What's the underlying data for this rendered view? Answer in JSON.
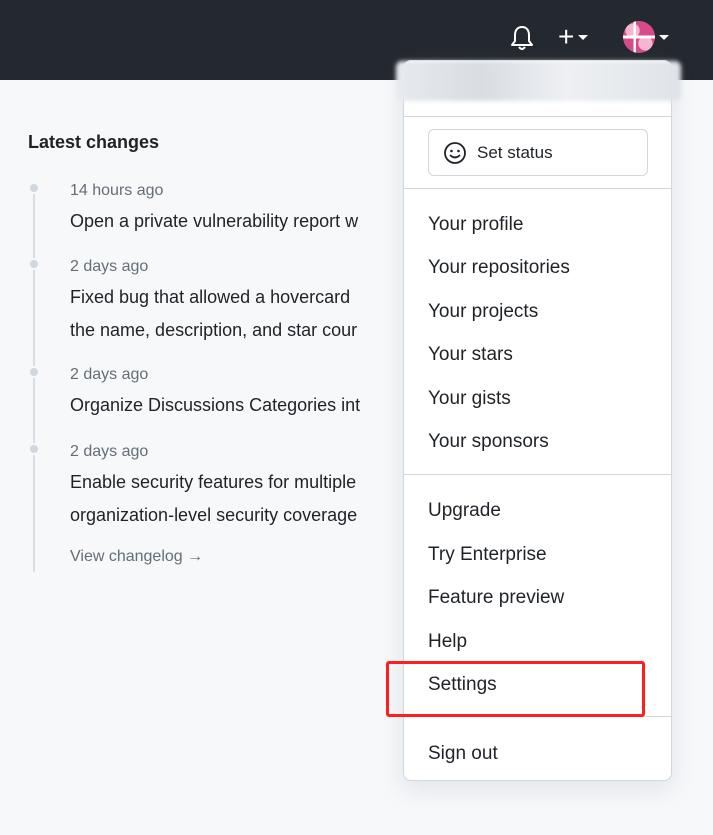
{
  "header": {
    "notifications_icon": "bell-icon",
    "create_icon": "plus-icon",
    "create_glyph": "+",
    "avatar_icon": "avatar"
  },
  "changelog": {
    "heading": "Latest changes",
    "entries": [
      {
        "time": "14 hours ago",
        "lines": [
          "Open a private vulnerability report w"
        ]
      },
      {
        "time": "2 days ago",
        "lines": [
          "Fixed bug that allowed a hovercard",
          "the name, description, and star cour"
        ]
      },
      {
        "time": "2 days ago",
        "lines": [
          "Organize Discussions Categories int"
        ]
      },
      {
        "time": "2 days ago",
        "lines": [
          "Enable security features for multiple",
          "organization-level security coverage"
        ]
      }
    ],
    "view_link": "View changelog →"
  },
  "user_menu": {
    "set_status": "Set status",
    "group1": [
      "Your profile",
      "Your repositories",
      "Your projects",
      "Your stars",
      "Your gists",
      "Your sponsors"
    ],
    "group2": [
      "Upgrade",
      "Try Enterprise",
      "Feature preview",
      "Help",
      "Settings"
    ],
    "sign_out": "Sign out"
  },
  "colors": {
    "header_bg": "#24292f",
    "page_bg": "#f6f8fa",
    "highlight": "#ff1e1e"
  }
}
